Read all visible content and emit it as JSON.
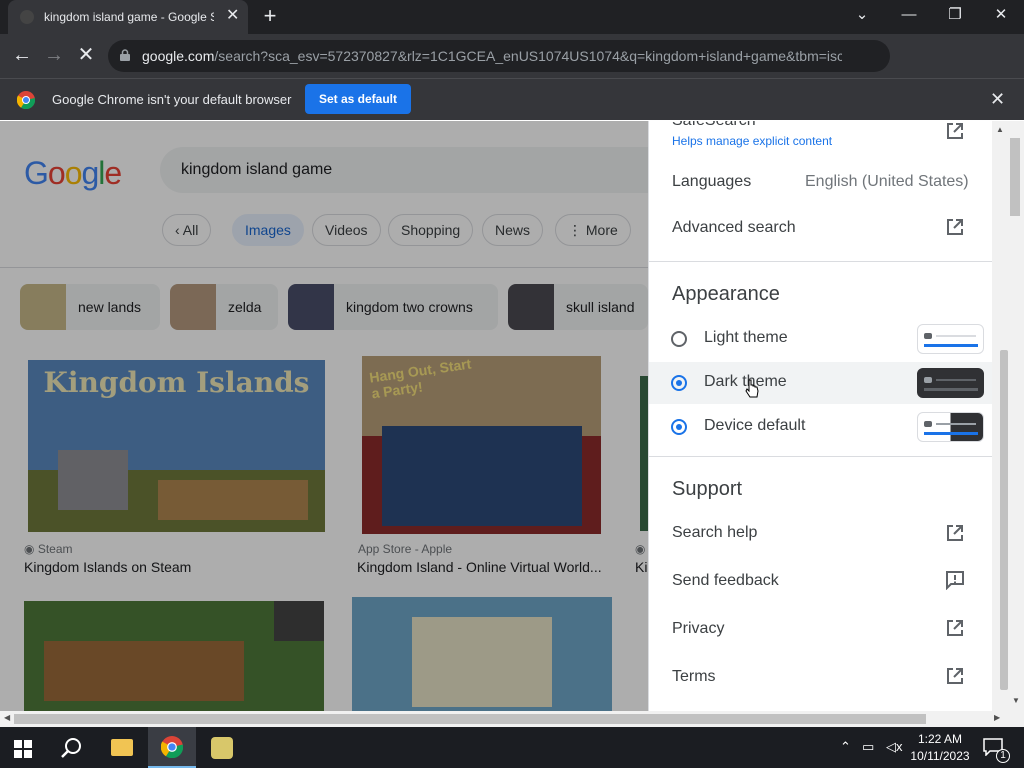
{
  "browser": {
    "tab_title": "kingdom island game - Google Search",
    "url_host": "google.com",
    "url_rest": "/search?sca_esv=572370827&rlz=1C1GCEA_enUS1074US1074&q=kingdom+island+game&tbm=isc...",
    "infobar_text": "Google Chrome isn't your default browser",
    "infobar_button": "Set as default"
  },
  "search": {
    "logo": "Google",
    "query": "kingdom island game",
    "tabs": [
      "All",
      "Images",
      "Videos",
      "Shopping",
      "News",
      "More"
    ],
    "selected_tab": "Images",
    "related": [
      "new lands",
      "zelda",
      "kingdom two crowns",
      "skull island"
    ]
  },
  "results": [
    {
      "source": "Steam",
      "caption": "Kingdom Islands on Steam",
      "image_text": "Kingdom Islands"
    },
    {
      "source": "App Store - Apple",
      "caption": "Kingdom Island - Online Virtual World...",
      "image_text": "Hang Out, Start a Party!"
    },
    {
      "source": "",
      "caption": "Ki",
      "image_text": ""
    }
  ],
  "panel": {
    "safesearch_label": "SafeSearch",
    "safesearch_sub": "Helps manage explicit content",
    "languages_label": "Languages",
    "languages_value": "English (United States)",
    "advanced_label": "Advanced search",
    "appearance_head": "Appearance",
    "themes": [
      {
        "label": "Light theme",
        "selected": false
      },
      {
        "label": "Dark theme",
        "selected": true
      },
      {
        "label": "Device default",
        "selected": true
      }
    ],
    "support_head": "Support",
    "support_items": [
      "Search help",
      "Send feedback",
      "Privacy",
      "Terms"
    ]
  },
  "taskbar": {
    "time": "1:22 AM",
    "date": "10/11/2023",
    "notification_count": "1"
  },
  "colors": {
    "accent": "#1a73e8",
    "chrome_dark": "#35363a"
  }
}
